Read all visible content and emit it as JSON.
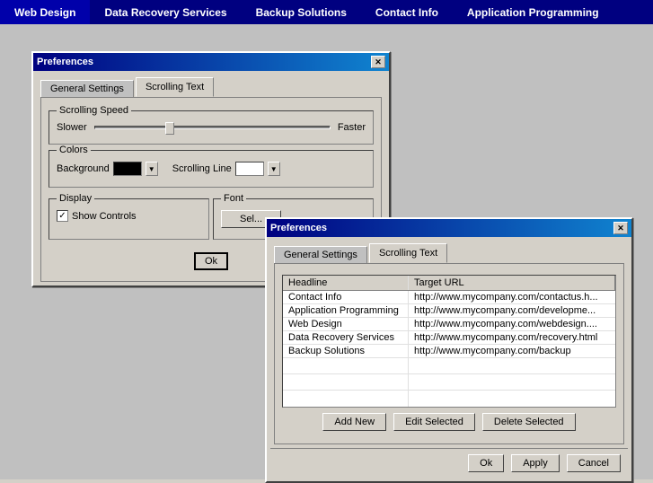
{
  "menubar": {
    "items": [
      {
        "id": "web-design",
        "label": "Web Design"
      },
      {
        "id": "data-recovery",
        "label": "Data Recovery Services"
      },
      {
        "id": "backup",
        "label": "Backup Solutions"
      },
      {
        "id": "contact",
        "label": "Contact Info"
      },
      {
        "id": "app-programming",
        "label": "Application Programming"
      }
    ]
  },
  "window1": {
    "title": "Preferences",
    "tabs": [
      {
        "id": "general",
        "label": "General Settings",
        "active": false
      },
      {
        "id": "scrolling",
        "label": "Scrolling Text",
        "active": true
      }
    ],
    "scrolling_speed": {
      "label": "Scrolling Speed",
      "slower_label": "Slower",
      "faster_label": "Faster"
    },
    "colors": {
      "label": "Colors",
      "background_label": "Background",
      "scrolling_line_label": "Scrolling Line",
      "bg_color": "#000000",
      "line_color": "#ffffff"
    },
    "display": {
      "label": "Display",
      "show_controls_label": "Show Controls",
      "checked": true
    },
    "font": {
      "label": "Font",
      "select_label": "Sel..."
    },
    "ok_label": "Ok"
  },
  "window2": {
    "title": "Preferences",
    "tabs": [
      {
        "id": "general",
        "label": "General Settings",
        "active": false
      },
      {
        "id": "scrolling",
        "label": "Scrolling Text",
        "active": true
      }
    ],
    "table": {
      "headers": [
        "Headline",
        "Target URL"
      ],
      "rows": [
        {
          "headline": "Contact Info",
          "url": "http://www.mycompany.com/contactus.h..."
        },
        {
          "headline": "Application Programming",
          "url": "http://www.mycompany.com/developme..."
        },
        {
          "headline": "Web Design",
          "url": "http://www.mycompany.com/webdesign...."
        },
        {
          "headline": "Data Recovery Services",
          "url": "http://www.mycompany.com/recovery.html"
        },
        {
          "headline": "Backup Solutions",
          "url": "http://www.mycompany.com/backup"
        }
      ]
    },
    "buttons": {
      "add_new": "Add New",
      "edit_selected": "Edit Selected",
      "delete_selected": "Delete Selected"
    },
    "footer": {
      "ok": "Ok",
      "apply": "Apply",
      "cancel": "Cancel"
    }
  }
}
